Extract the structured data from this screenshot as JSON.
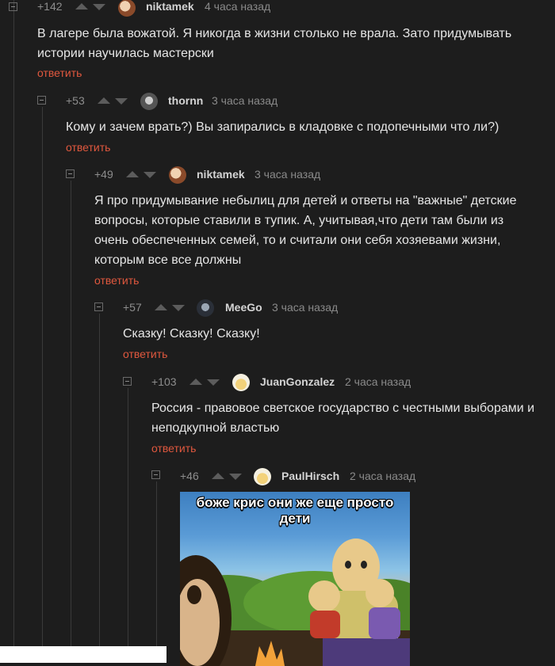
{
  "comments": [
    {
      "rating": "+142",
      "author": "niktamek",
      "time": "4 часа назад",
      "text": "В лагере была вожатой. Я никогда в жизни столько не врала. Зато придумывать истории научилась мастерски",
      "reply": "ответить"
    },
    {
      "rating": "+53",
      "author": "thornn",
      "time": "3 часа назад",
      "text": "Кому и зачем врать?) Вы запирались в кладовке с подопечными что ли?)",
      "reply": "ответить"
    },
    {
      "rating": "+49",
      "author": "niktamek",
      "time": "3 часа назад",
      "text": "Я про придумывание небылиц для детей и ответы на \"важные\" детские вопросы, которые ставили в тупик. А, учитывая,что дети там были из очень обеспеченных семей, то и считали они себя хозяевами жизни, которым все все должны",
      "reply": "ответить"
    },
    {
      "rating": "+57",
      "author": "MeeGo",
      "time": "3 часа назад",
      "text": "Сказку! Сказку! Сказку!",
      "reply": "ответить"
    },
    {
      "rating": "+103",
      "author": "JuanGonzalez",
      "time": "2 часа назад",
      "text": "Россия - правовое светское государство с честными выборами и неподкупной властью",
      "reply": "ответить"
    },
    {
      "rating": "+46",
      "author": "PaulHirsch",
      "time": "2 часа назад",
      "meme_caption": "боже крис они же еще просто дети"
    }
  ]
}
